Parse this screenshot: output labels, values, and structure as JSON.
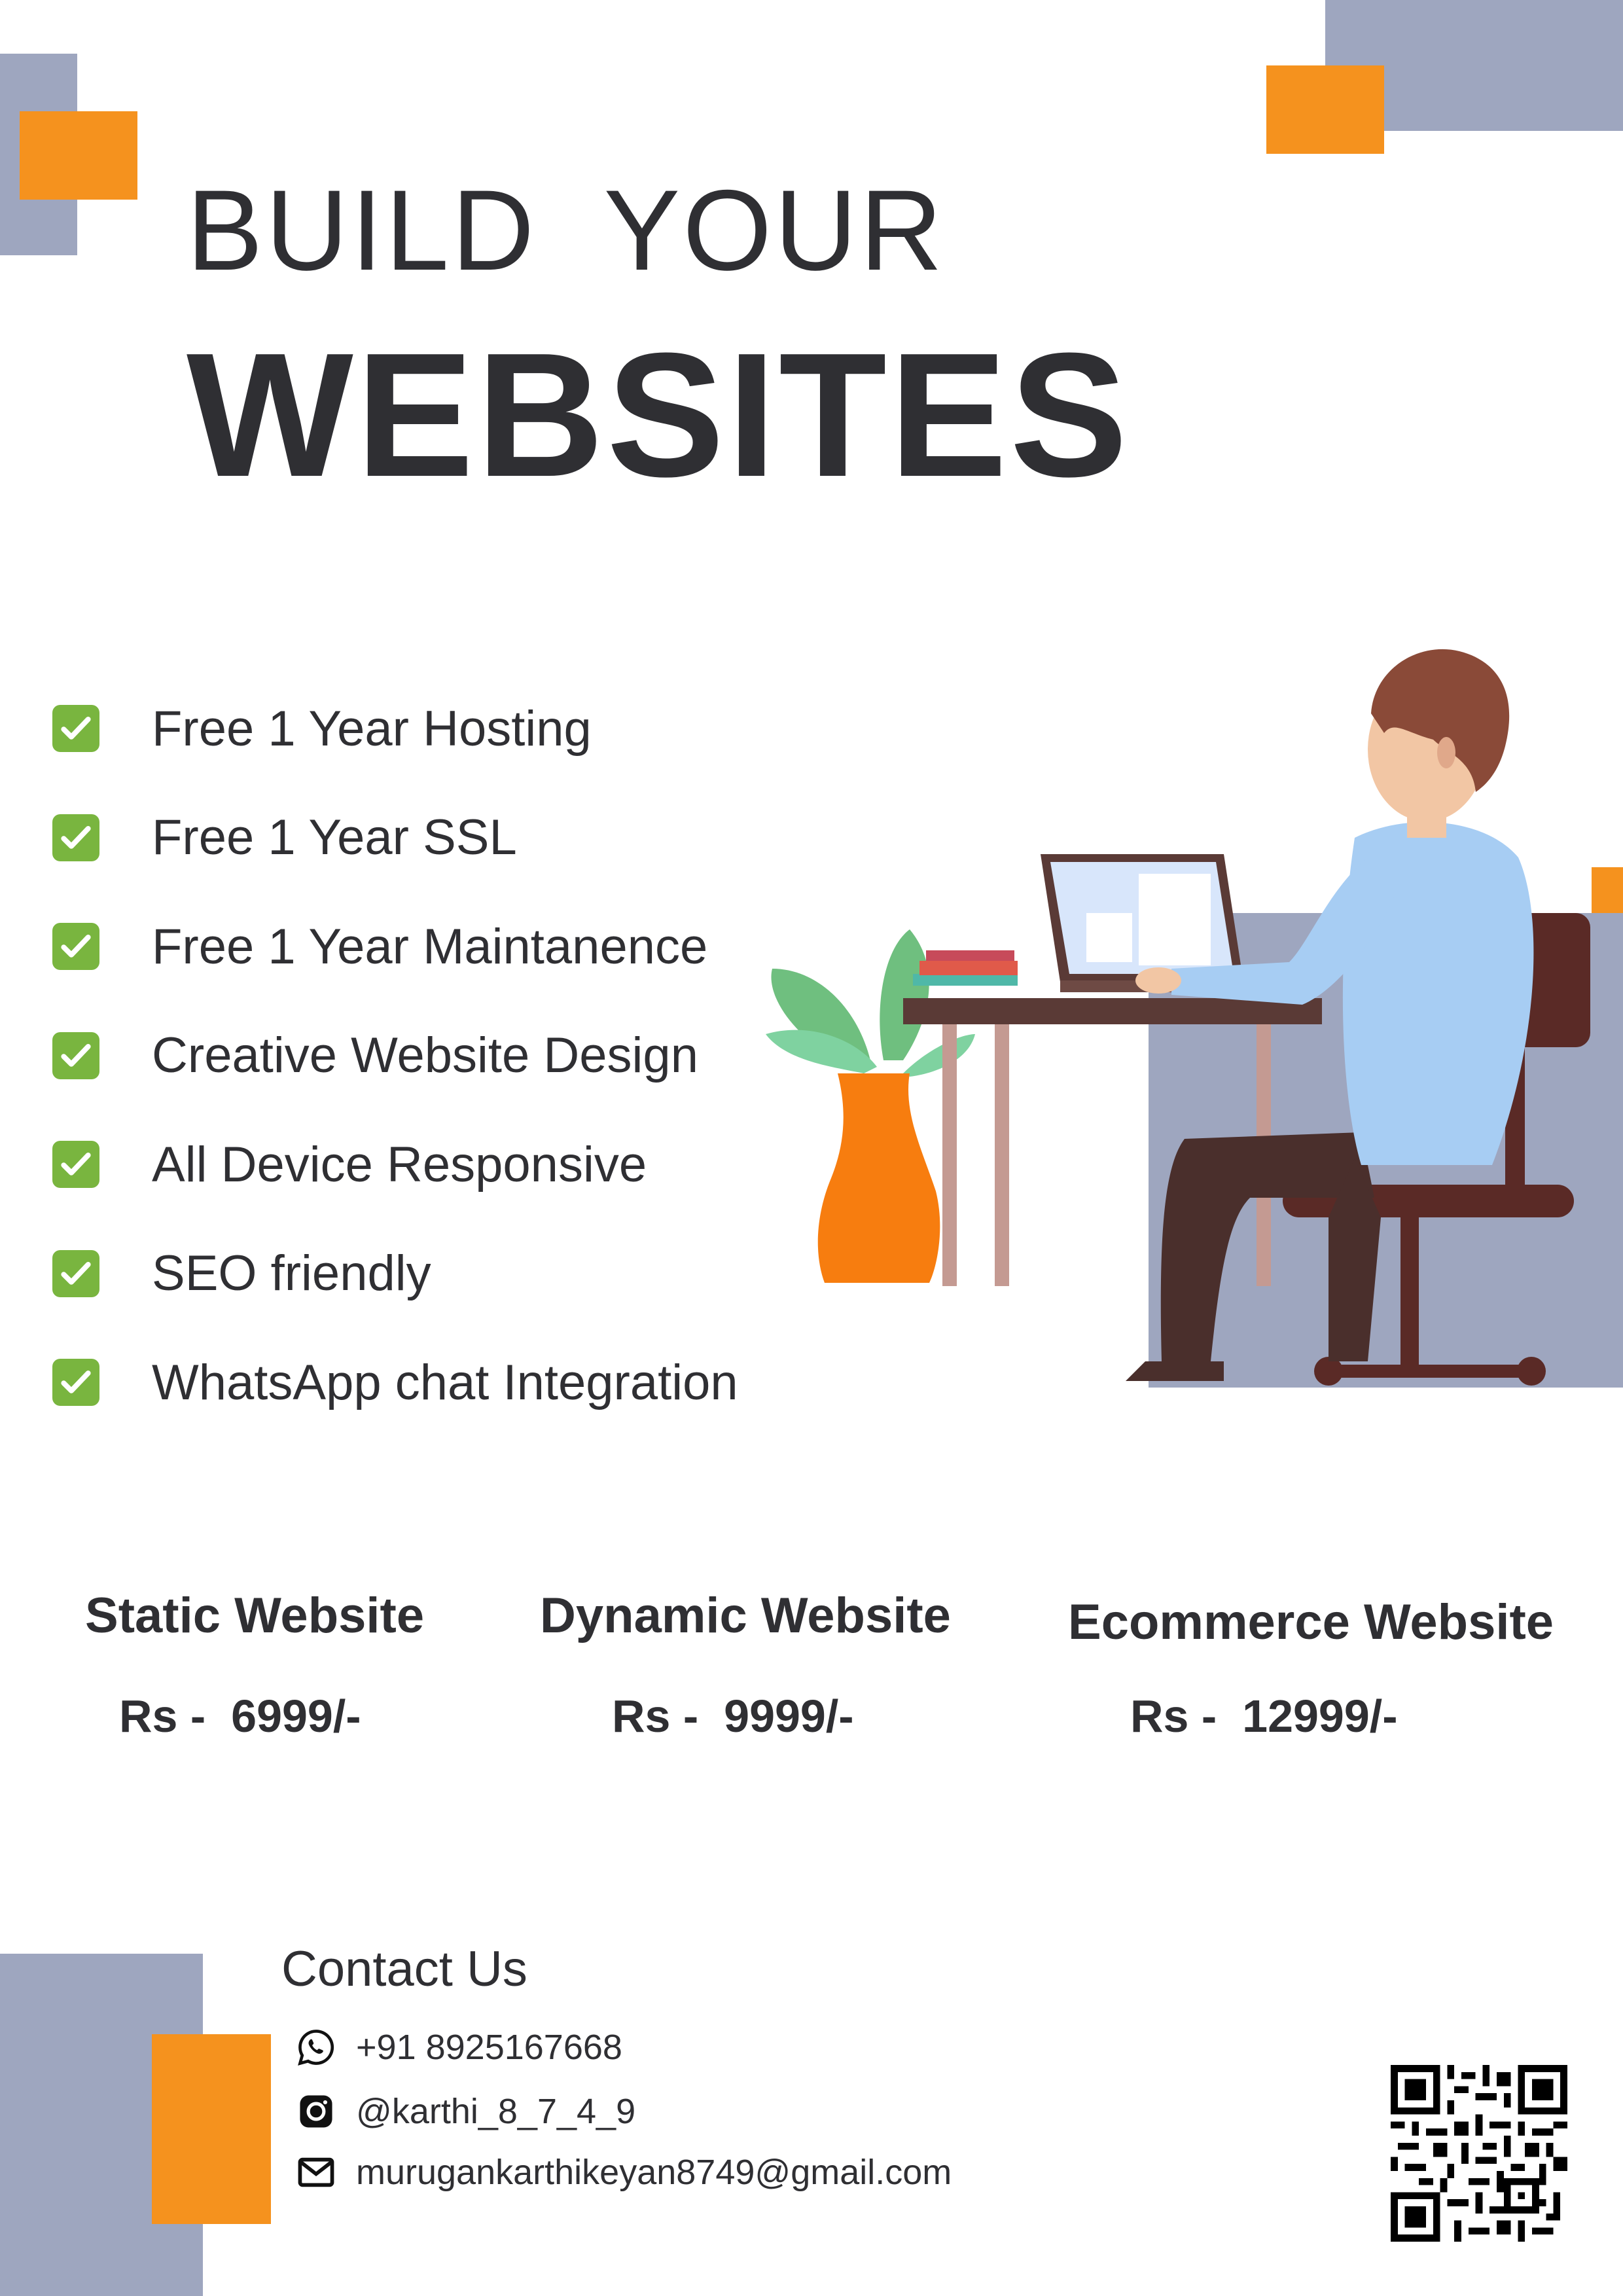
{
  "header": {
    "line1": "BUILD  YOUR",
    "line2": "WEBSITES"
  },
  "features": [
    {
      "label": "Free 1 Year Hosting",
      "icon": "check-box-icon"
    },
    {
      "label": "Free 1 Year SSL",
      "icon": "check-box-icon"
    },
    {
      "label": "Free 1 Year Maintanence",
      "icon": "check-box-icon"
    },
    {
      "label": "Creative Website Design",
      "icon": "check-box-icon"
    },
    {
      "label": "All Device Responsive",
      "icon": "check-box-icon"
    },
    {
      "label": "SEO friendly",
      "icon": "check-box-icon"
    },
    {
      "label": "WhatsApp chat Integration",
      "icon": "check-box-icon"
    }
  ],
  "pricing": [
    {
      "title": "Static Website",
      "price": "Rs -  6999/-"
    },
    {
      "title": "Dynamic Website",
      "price": "Rs -  9999/-"
    },
    {
      "title": "Ecommerce Website",
      "price": "Rs -  12999/-"
    }
  ],
  "contact": {
    "title": "Contact Us",
    "phone": "+91 8925167668",
    "instagram": "@karthi_8_7_4_9",
    "email": "murugankarthikeyan8749@gmail.com"
  },
  "colors": {
    "accent_orange": "#f5921e",
    "accent_grey": "#9ea6bf",
    "text": "#2f2f33",
    "check_green": "#79b53f"
  }
}
